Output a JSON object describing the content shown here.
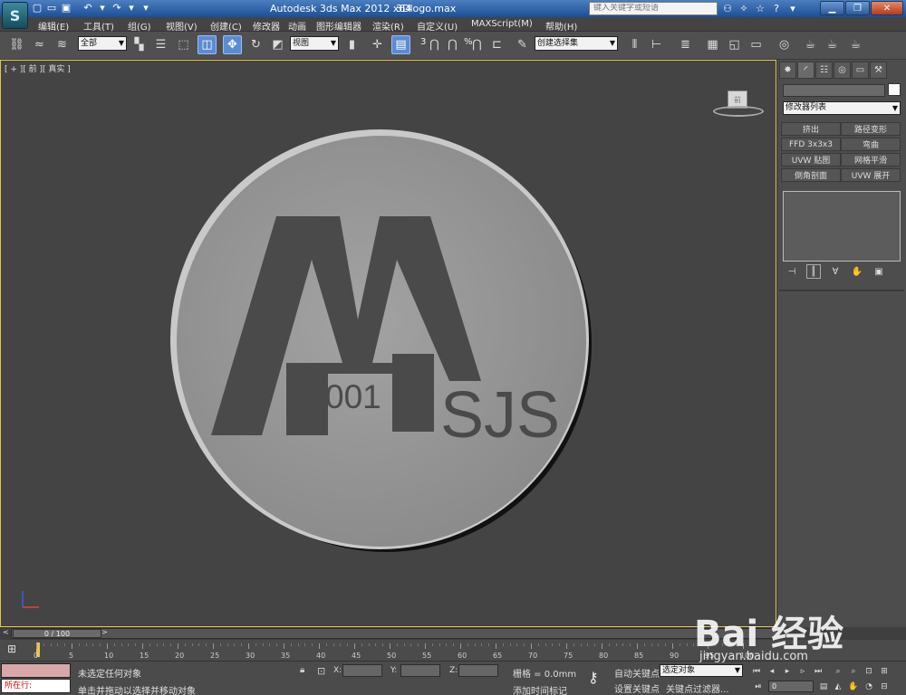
{
  "titlebar": {
    "app_title": "Autodesk 3ds Max  2012 x64",
    "file_name": "3Dlogo.max",
    "search_placeholder": "键入关键字或短语",
    "logo": "S"
  },
  "menu": [
    "编辑(E)",
    "工具(T)",
    "组(G)",
    "视图(V)",
    "创建(C)",
    "修改器",
    "动画",
    "图形编辑器",
    "渲染(R)",
    "自定义(U)",
    "MAXScript(M)",
    "帮助(H)"
  ],
  "toolbar": {
    "selection_filter": "全部",
    "ref_coord": "视图",
    "angle_snap": "3",
    "percent_snap": "%",
    "named_selection": "创建选择集"
  },
  "viewport": {
    "label": "[ + ][ 前 ][ 真实 ]",
    "viewcube_face": "前",
    "logo_digits": "001",
    "logo_letters": "SJS"
  },
  "command_panel": {
    "modifier_list": "修改器列表",
    "modifier_buttons": [
      "挤出",
      "路径变形",
      "FFD 3x3x3",
      "弯曲",
      "UVW 贴图",
      "网格平滑",
      "倒角剖面",
      "UVW 展开"
    ]
  },
  "timeline": {
    "frame_counter": "0 / 100",
    "ticks": [
      0,
      5,
      10,
      15,
      20,
      25,
      30,
      35,
      40,
      45,
      50,
      55,
      60,
      65,
      70,
      75,
      80,
      85,
      90,
      95,
      100
    ]
  },
  "status": {
    "maxscript_label": "所在行:",
    "selection_status": "未选定任何对象",
    "prompt": "单击并拖动以选择并移动对象",
    "x_label": "X:",
    "y_label": "Y:",
    "z_label": "Z:",
    "grid": "栅格 = 0.0mm",
    "add_time_tag": "添加时间标记",
    "auto_key": "自动关键点",
    "set_key": "设置关键点",
    "selected_dropdown": "选定对象",
    "key_filters": "关键点过滤器...",
    "current_frame": "0"
  },
  "watermark": {
    "brand": "Bai 经验",
    "url": "jingyan.baidu.com"
  },
  "colors": {
    "title_bar": "#2a5fa8",
    "viewport_border": "#e9c34b",
    "viewport_bg": "#444444",
    "disc": "#9a9a9a",
    "logo_text": "#4a4a4a"
  }
}
